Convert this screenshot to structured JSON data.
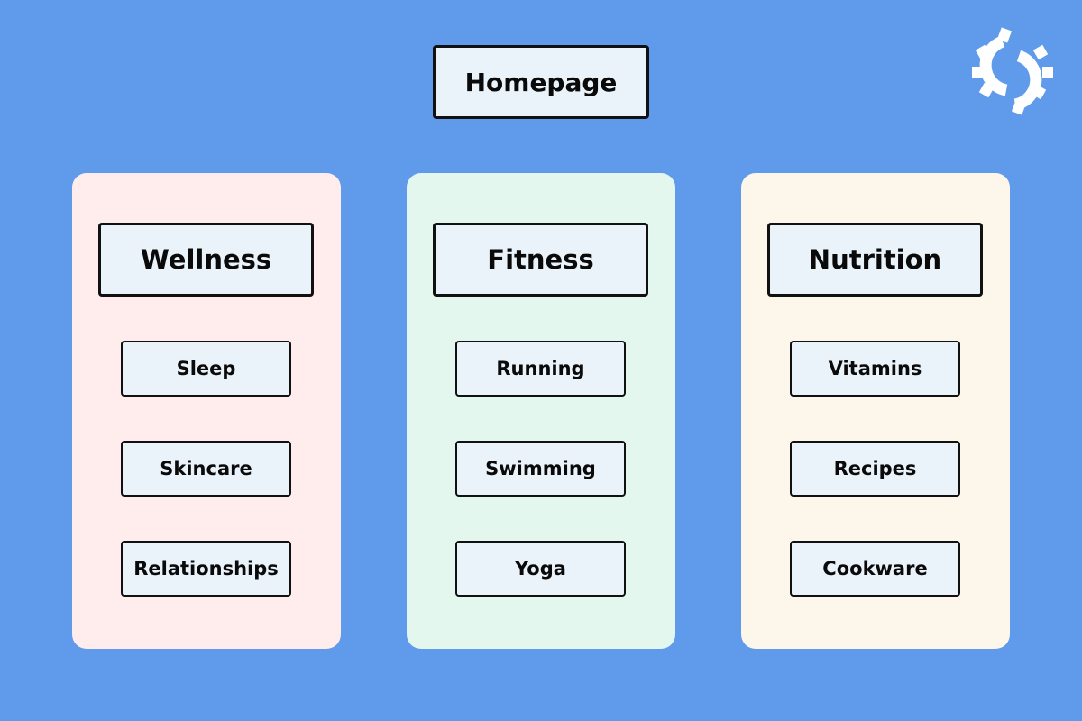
{
  "root": {
    "label": "Homepage"
  },
  "logo": {
    "icon": "gear-sync-icon"
  },
  "categories": [
    {
      "label": "Wellness",
      "color": "#ffecec",
      "items": [
        "Sleep",
        "Skincare",
        "Relationships"
      ]
    },
    {
      "label": "Fitness",
      "color": "#e3f7ef",
      "items": [
        "Running",
        "Swimming",
        "Yoga"
      ]
    },
    {
      "label": "Nutrition",
      "color": "#fdf6ea",
      "items": [
        "Vitamins",
        "Recipes",
        "Cookware"
      ]
    }
  ],
  "colors": {
    "background": "#5f9bea",
    "box": "#eaf2fa",
    "border": "#111111"
  }
}
